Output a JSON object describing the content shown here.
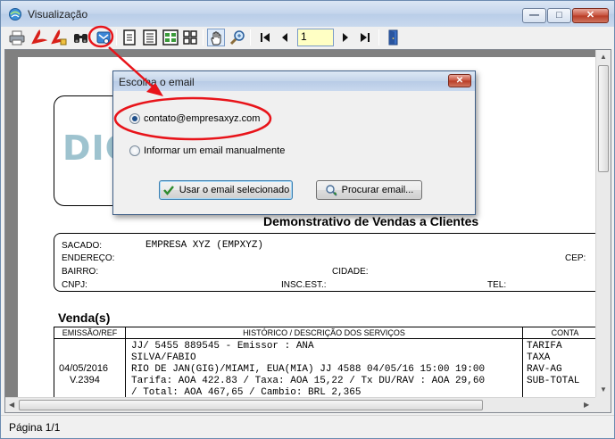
{
  "window": {
    "title": "Visualização",
    "controls": {
      "minimize": "—",
      "maximize": "□",
      "close": "✕"
    }
  },
  "toolbar": {
    "page_value": "1",
    "icons": [
      "printer-icon",
      "pdf-export-icon",
      "pdf-export-alt-icon",
      "find-icon",
      "email-icon",
      "single-page-icon",
      "two-pages-icon",
      "multi-pages-icon",
      "grid-pages-icon",
      "hand-pan-icon",
      "zoom-icon",
      "first-page-icon",
      "prev-page-icon",
      "next-page-icon",
      "last-page-icon",
      "exit-icon"
    ]
  },
  "dialog": {
    "title": "Escolha o email",
    "close_glyph": "✕",
    "options": [
      {
        "label": "contato@empresaxyz.com",
        "checked": true
      },
      {
        "label": "Informar um email manualmente",
        "checked": false
      }
    ],
    "use_button": "Usar o email selecionado",
    "search_button": "Procurar email..."
  },
  "report": {
    "logo_text": "DIC",
    "title": "Demonstrativo de Vendas a Clientes",
    "info": {
      "sacado_label": "SACADO:",
      "sacado_value": "EMPRESA XYZ  (EMPXYZ)",
      "endereco_label": "ENDEREÇO:",
      "cep_label": "CEP:",
      "bairro_label": "BAIRRO:",
      "cidade_label": "CIDADE:",
      "cnpj_label": "CNPJ:",
      "insc_label": "INSC.EST.:",
      "tel_label": "TEL:"
    },
    "section_title": "Venda(s)",
    "columns": [
      "EMISSÃO/REF",
      "HISTÓRICO / DESCRIÇÃO DOS SERVIÇOS",
      "CONTA"
    ],
    "row": {
      "emissao": "04/05/2016",
      "ref": "V.2394",
      "historico": [
        "JJ/ 5455 889545 - Emissor : ANA",
        "SILVA/FABIO",
        "RIO DE JAN(GIG)/MIAMI, EUA(MIA) JJ 4588 04/05/16 15:00 19:00",
        "Tarifa: AOA 422.83 / Taxa: AOA 15,22 / Tx DU/RAV : AOA 29,60",
        "/ Total: AOA 467,65 / Cambio: BRL 2,365"
      ],
      "conta": [
        "TARIFA",
        "TAXA",
        "RAV-AG",
        "SUB-TOTAL"
      ]
    }
  },
  "statusbar": {
    "text": "Página 1/1"
  },
  "colors": {
    "annotation": "#e8141a",
    "logo": "#9ec3cf",
    "page_input_bg": "#ffffc4"
  }
}
